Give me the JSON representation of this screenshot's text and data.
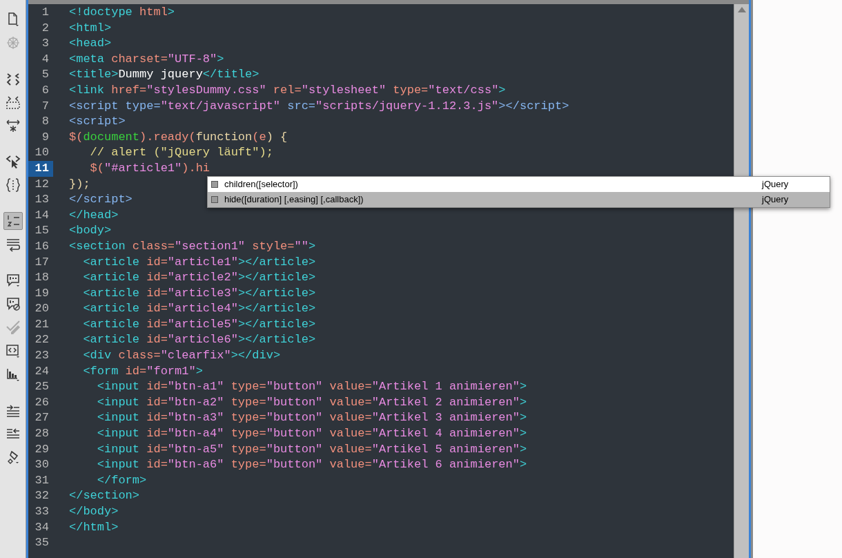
{
  "toolbar": {
    "groups": [
      [
        {
          "kind": "file",
          "on": false,
          "disabled": false
        },
        {
          "kind": "live",
          "on": false,
          "disabled": true
        }
      ],
      [
        {
          "kind": "collapse",
          "on": false,
          "disabled": false
        },
        {
          "kind": "collapseselection",
          "on": false,
          "disabled": false
        },
        {
          "kind": "expand",
          "on": false,
          "disabled": false
        }
      ],
      [
        {
          "kind": "selectparent",
          "on": false,
          "disabled": false
        },
        {
          "kind": "braces",
          "on": false,
          "disabled": false
        }
      ],
      [
        {
          "kind": "linenumbers",
          "on": true,
          "disabled": false
        },
        {
          "kind": "wrap",
          "on": false,
          "disabled": false
        }
      ],
      [
        {
          "kind": "comment",
          "on": false,
          "disabled": false
        },
        {
          "kind": "uncomment",
          "on": false,
          "disabled": false
        },
        {
          "kind": "pencil",
          "on": false,
          "disabled": true
        },
        {
          "kind": "codetag",
          "on": false,
          "disabled": false
        },
        {
          "kind": "chart",
          "on": false,
          "disabled": false
        }
      ],
      [
        {
          "kind": "indent",
          "on": false,
          "disabled": false
        },
        {
          "kind": "outdent",
          "on": false,
          "disabled": false
        },
        {
          "kind": "format",
          "on": false,
          "disabled": false
        }
      ]
    ]
  },
  "editor": {
    "lines": [
      {
        "number": "1",
        "current": false,
        "tokens": [
          {
            "kind": "tag",
            "text": "<!doctype "
          },
          {
            "kind": "attr",
            "text": "html"
          },
          {
            "kind": "tag",
            "text": ">"
          }
        ]
      },
      {
        "number": "2",
        "current": false,
        "tokens": [
          {
            "kind": "tag",
            "text": "<html>"
          }
        ]
      },
      {
        "number": "3",
        "current": false,
        "tokens": [
          {
            "kind": "tag",
            "text": "<head>"
          }
        ]
      },
      {
        "number": "4",
        "current": false,
        "tokens": [
          {
            "kind": "tag",
            "text": "<meta"
          },
          {
            "kind": "attr",
            "text": " charset="
          },
          {
            "kind": "value",
            "text": "\"UTF-8\""
          },
          {
            "kind": "tag",
            "text": ">"
          }
        ]
      },
      {
        "number": "5",
        "current": false,
        "tokens": [
          {
            "kind": "tag",
            "text": "<title>"
          },
          {
            "kind": "text",
            "text": "Dummy jquery"
          },
          {
            "kind": "tag",
            "text": "</title>"
          }
        ]
      },
      {
        "number": "6",
        "current": false,
        "tokens": [
          {
            "kind": "tag",
            "text": "<link"
          },
          {
            "kind": "attr",
            "text": " href="
          },
          {
            "kind": "value",
            "text": "\"stylesDummy.css\""
          },
          {
            "kind": "attr",
            "text": " rel="
          },
          {
            "kind": "value",
            "text": "\"stylesheet\""
          },
          {
            "kind": "attr",
            "text": " type="
          },
          {
            "kind": "value",
            "text": "\"text/css\""
          },
          {
            "kind": "tag",
            "text": ">"
          }
        ]
      },
      {
        "number": "7",
        "current": false,
        "tokens": [
          {
            "kind": "script",
            "text": "<script type="
          },
          {
            "kind": "value",
            "text": "\"text/javascript\""
          },
          {
            "kind": "script",
            "text": " src="
          },
          {
            "kind": "value",
            "text": "\"scripts/jquery-1.12.3.js\""
          },
          {
            "kind": "script",
            "text": "></script>"
          }
        ]
      },
      {
        "number": "8",
        "current": false,
        "tokens": [
          {
            "kind": "script",
            "text": "<script>"
          }
        ]
      },
      {
        "number": "9",
        "current": false,
        "tokens": [
          {
            "kind": "js",
            "text": "$("
          },
          {
            "kind": "object",
            "text": "document"
          },
          {
            "kind": "js",
            "text": ").ready("
          },
          {
            "kind": "keyword",
            "text": "function"
          },
          {
            "kind": "js",
            "text": "(e"
          },
          {
            "kind": "keyword",
            "text": ") {"
          }
        ]
      },
      {
        "number": "10",
        "current": false,
        "tokens": [
          {
            "kind": "comment",
            "text": "   // alert (\"jQuery läuft\");"
          }
        ]
      },
      {
        "number": "11",
        "current": true,
        "tokens": [
          {
            "kind": "js",
            "text": "   $("
          },
          {
            "kind": "value",
            "text": "\"#article1\""
          },
          {
            "kind": "js",
            "text": ").hi"
          }
        ]
      },
      {
        "number": "12",
        "current": false,
        "tokens": [
          {
            "kind": "keyword",
            "text": "});"
          }
        ]
      },
      {
        "number": "13",
        "current": false,
        "tokens": [
          {
            "kind": "script",
            "text": "</script>"
          }
        ]
      },
      {
        "number": "14",
        "current": false,
        "tokens": [
          {
            "kind": "tag",
            "text": "</head>"
          }
        ]
      },
      {
        "number": "15",
        "current": false,
        "tokens": [
          {
            "kind": "tag",
            "text": "<body>"
          }
        ]
      },
      {
        "number": "16",
        "current": false,
        "tokens": [
          {
            "kind": "tag",
            "text": "<section"
          },
          {
            "kind": "attr",
            "text": " class="
          },
          {
            "kind": "value",
            "text": "\"section1\""
          },
          {
            "kind": "attr",
            "text": " style="
          },
          {
            "kind": "value",
            "text": "\"\""
          },
          {
            "kind": "tag",
            "text": ">"
          }
        ]
      },
      {
        "number": "17",
        "current": false,
        "tokens": [
          {
            "kind": "tag",
            "text": "  <article"
          },
          {
            "kind": "attr",
            "text": " id="
          },
          {
            "kind": "value",
            "text": "\"article1\""
          },
          {
            "kind": "tag",
            "text": "></article>"
          }
        ]
      },
      {
        "number": "18",
        "current": false,
        "tokens": [
          {
            "kind": "tag",
            "text": "  <article"
          },
          {
            "kind": "attr",
            "text": " id="
          },
          {
            "kind": "value",
            "text": "\"article2\""
          },
          {
            "kind": "tag",
            "text": "></article>"
          }
        ]
      },
      {
        "number": "19",
        "current": false,
        "tokens": [
          {
            "kind": "tag",
            "text": "  <article"
          },
          {
            "kind": "attr",
            "text": " id="
          },
          {
            "kind": "value",
            "text": "\"article3\""
          },
          {
            "kind": "tag",
            "text": "></article>"
          }
        ]
      },
      {
        "number": "20",
        "current": false,
        "tokens": [
          {
            "kind": "tag",
            "text": "  <article"
          },
          {
            "kind": "attr",
            "text": " id="
          },
          {
            "kind": "value",
            "text": "\"article4\""
          },
          {
            "kind": "tag",
            "text": "></article>"
          }
        ]
      },
      {
        "number": "21",
        "current": false,
        "tokens": [
          {
            "kind": "tag",
            "text": "  <article"
          },
          {
            "kind": "attr",
            "text": " id="
          },
          {
            "kind": "value",
            "text": "\"article5\""
          },
          {
            "kind": "tag",
            "text": "></article>"
          }
        ]
      },
      {
        "number": "22",
        "current": false,
        "tokens": [
          {
            "kind": "tag",
            "text": "  <article"
          },
          {
            "kind": "attr",
            "text": " id="
          },
          {
            "kind": "value",
            "text": "\"article6\""
          },
          {
            "kind": "tag",
            "text": "></article>"
          }
        ]
      },
      {
        "number": "23",
        "current": false,
        "tokens": [
          {
            "kind": "tag",
            "text": "  <div"
          },
          {
            "kind": "attr",
            "text": " class="
          },
          {
            "kind": "value",
            "text": "\"clearfix\""
          },
          {
            "kind": "tag",
            "text": "></div>"
          }
        ]
      },
      {
        "number": "24",
        "current": false,
        "tokens": [
          {
            "kind": "tag",
            "text": "  <form"
          },
          {
            "kind": "attr",
            "text": " id="
          },
          {
            "kind": "value",
            "text": "\"form1\""
          },
          {
            "kind": "tag",
            "text": ">"
          }
        ]
      },
      {
        "number": "25",
        "current": false,
        "tokens": [
          {
            "kind": "tag",
            "text": "    <input"
          },
          {
            "kind": "attr",
            "text": " id="
          },
          {
            "kind": "value",
            "text": "\"btn-a1\""
          },
          {
            "kind": "attr",
            "text": " type="
          },
          {
            "kind": "value",
            "text": "\"button\""
          },
          {
            "kind": "attr",
            "text": " value="
          },
          {
            "kind": "value",
            "text": "\"Artikel 1 animieren\""
          },
          {
            "kind": "tag",
            "text": ">"
          }
        ]
      },
      {
        "number": "26",
        "current": false,
        "tokens": [
          {
            "kind": "tag",
            "text": "    <input"
          },
          {
            "kind": "attr",
            "text": " id="
          },
          {
            "kind": "value",
            "text": "\"btn-a2\""
          },
          {
            "kind": "attr",
            "text": " type="
          },
          {
            "kind": "value",
            "text": "\"button\""
          },
          {
            "kind": "attr",
            "text": " value="
          },
          {
            "kind": "value",
            "text": "\"Artikel 2 animieren\""
          },
          {
            "kind": "tag",
            "text": ">"
          }
        ]
      },
      {
        "number": "27",
        "current": false,
        "tokens": [
          {
            "kind": "tag",
            "text": "    <input"
          },
          {
            "kind": "attr",
            "text": " id="
          },
          {
            "kind": "value",
            "text": "\"btn-a3\""
          },
          {
            "kind": "attr",
            "text": " type="
          },
          {
            "kind": "value",
            "text": "\"button\""
          },
          {
            "kind": "attr",
            "text": " value="
          },
          {
            "kind": "value",
            "text": "\"Artikel 3 animieren\""
          },
          {
            "kind": "tag",
            "text": ">"
          }
        ]
      },
      {
        "number": "28",
        "current": false,
        "tokens": [
          {
            "kind": "tag",
            "text": "    <input"
          },
          {
            "kind": "attr",
            "text": " id="
          },
          {
            "kind": "value",
            "text": "\"btn-a4\""
          },
          {
            "kind": "attr",
            "text": " type="
          },
          {
            "kind": "value",
            "text": "\"button\""
          },
          {
            "kind": "attr",
            "text": " value="
          },
          {
            "kind": "value",
            "text": "\"Artikel 4 animieren\""
          },
          {
            "kind": "tag",
            "text": ">"
          }
        ]
      },
      {
        "number": "29",
        "current": false,
        "tokens": [
          {
            "kind": "tag",
            "text": "    <input"
          },
          {
            "kind": "attr",
            "text": " id="
          },
          {
            "kind": "value",
            "text": "\"btn-a5\""
          },
          {
            "kind": "attr",
            "text": " type="
          },
          {
            "kind": "value",
            "text": "\"button\""
          },
          {
            "kind": "attr",
            "text": " value="
          },
          {
            "kind": "value",
            "text": "\"Artikel 5 animieren\""
          },
          {
            "kind": "tag",
            "text": ">"
          }
        ]
      },
      {
        "number": "30",
        "current": false,
        "tokens": [
          {
            "kind": "tag",
            "text": "    <input"
          },
          {
            "kind": "attr",
            "text": " id="
          },
          {
            "kind": "value",
            "text": "\"btn-a6\""
          },
          {
            "kind": "attr",
            "text": " type="
          },
          {
            "kind": "value",
            "text": "\"button\""
          },
          {
            "kind": "attr",
            "text": " value="
          },
          {
            "kind": "value",
            "text": "\"Artikel 6 animieren\""
          },
          {
            "kind": "tag",
            "text": ">"
          }
        ]
      },
      {
        "number": "31",
        "current": false,
        "tokens": [
          {
            "kind": "tag",
            "text": "    </form>"
          }
        ]
      },
      {
        "number": "32",
        "current": false,
        "tokens": [
          {
            "kind": "tag",
            "text": "</section>"
          }
        ]
      },
      {
        "number": "33",
        "current": false,
        "tokens": [
          {
            "kind": "tag",
            "text": "</body>"
          }
        ]
      },
      {
        "number": "34",
        "current": false,
        "tokens": [
          {
            "kind": "tag",
            "text": "</html>"
          }
        ]
      },
      {
        "number": "35",
        "current": false
      }
    ]
  },
  "autocomplete": {
    "items": [
      {
        "label": "children([selector])",
        "source": "jQuery",
        "selected": false
      },
      {
        "label": "hide([duration] [,easing] [,callback])",
        "source": "jQuery",
        "selected": true
      }
    ]
  }
}
